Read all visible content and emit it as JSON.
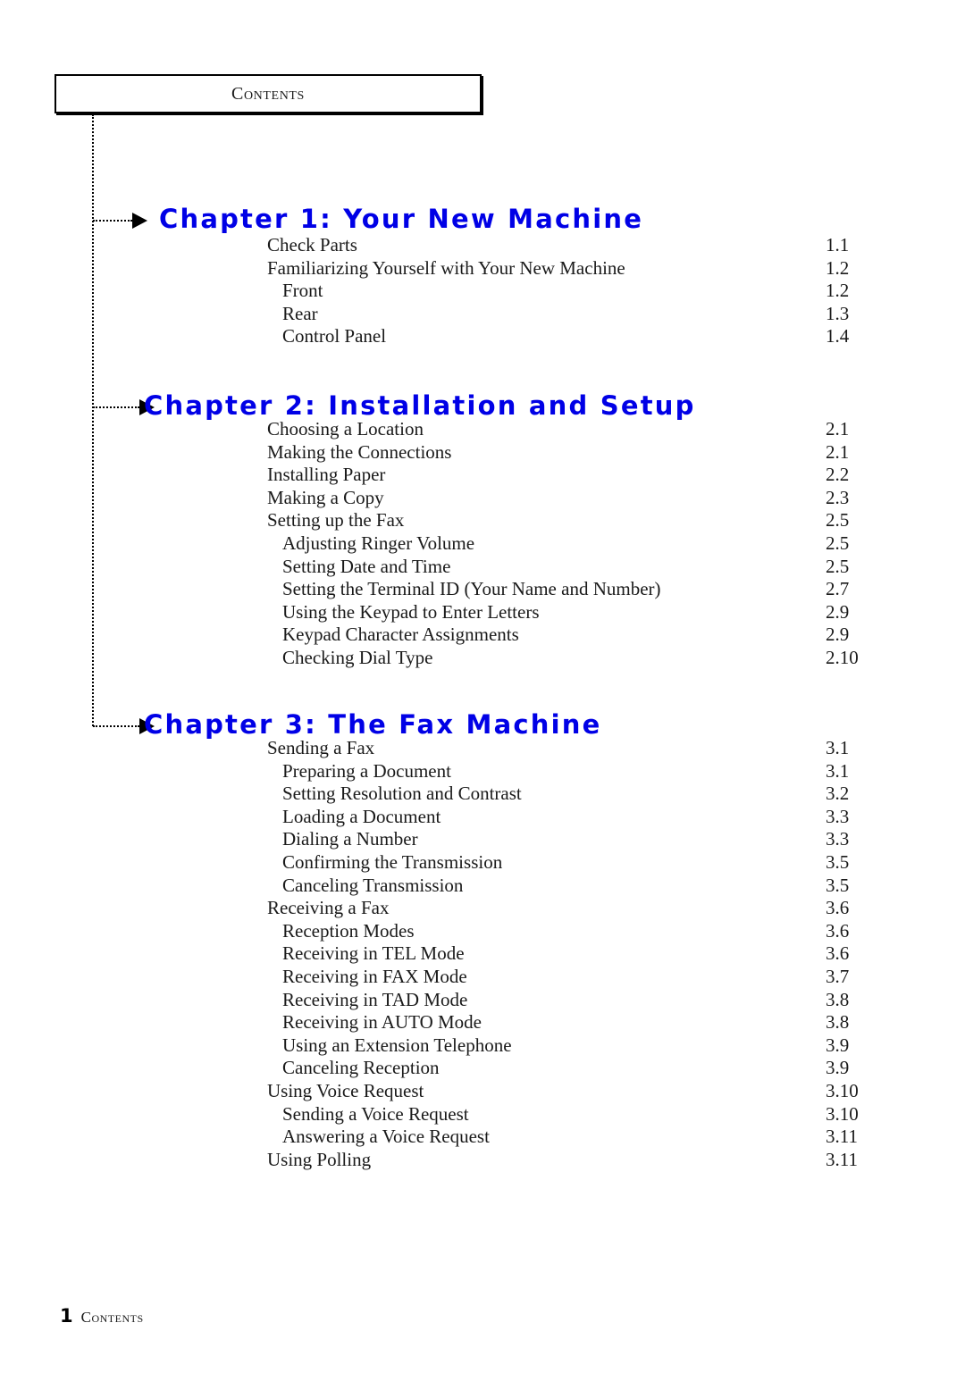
{
  "header": {
    "title": "Contents"
  },
  "footer": {
    "number": "1",
    "label": "Contents"
  },
  "colors": {
    "chapter_heading": "#0000E6",
    "text": "#1a1a1a",
    "rule": "#000000"
  },
  "chapters": [
    {
      "heading": "Chapter 1: Your New Machine",
      "entries": [
        {
          "label": "Check Parts",
          "page": "1.1",
          "level": 1
        },
        {
          "label": "Familiarizing Yourself with Your New Machine",
          "page": "1.2",
          "level": 1
        },
        {
          "label": "Front",
          "page": "1.2",
          "level": 2
        },
        {
          "label": "Rear",
          "page": "1.3",
          "level": 2
        },
        {
          "label": "Control Panel",
          "page": "1.4",
          "level": 2
        }
      ]
    },
    {
      "heading": "Chapter 2: Installation and Setup",
      "entries": [
        {
          "label": "Choosing a Location",
          "page": "2.1",
          "level": 1
        },
        {
          "label": "Making the Connections",
          "page": "2.1",
          "level": 1
        },
        {
          "label": "Installing Paper",
          "page": "2.2",
          "level": 1
        },
        {
          "label": "Making a Copy",
          "page": "2.3",
          "level": 1
        },
        {
          "label": "Setting up the Fax",
          "page": "2.5",
          "level": 1
        },
        {
          "label": "Adjusting Ringer Volume",
          "page": "2.5",
          "level": 2
        },
        {
          "label": "Setting Date and Time",
          "page": "2.5",
          "level": 2
        },
        {
          "label": "Setting the Terminal ID (Your Name and Number)",
          "page": "2.7",
          "level": 2
        },
        {
          "label": "Using the Keypad to Enter Letters",
          "page": "2.9",
          "level": 2
        },
        {
          "label": "Keypad Character Assignments",
          "page": "2.9",
          "level": 2
        },
        {
          "label": "Checking Dial Type",
          "page": "2.10",
          "level": 2
        }
      ]
    },
    {
      "heading": "Chapter 3: The Fax Machine",
      "entries": [
        {
          "label": "Sending a Fax",
          "page": "3.1",
          "level": 1
        },
        {
          "label": "Preparing a Document",
          "page": "3.1",
          "level": 2
        },
        {
          "label": "Setting Resolution and Contrast",
          "page": "3.2",
          "level": 2
        },
        {
          "label": "Loading a Document",
          "page": "3.3",
          "level": 2
        },
        {
          "label": "Dialing a Number",
          "page": "3.3",
          "level": 2
        },
        {
          "label": "Confirming the Transmission",
          "page": "3.5",
          "level": 2
        },
        {
          "label": "Canceling Transmission",
          "page": "3.5",
          "level": 2
        },
        {
          "label": "Receiving a Fax",
          "page": "3.6",
          "level": 1
        },
        {
          "label": "Reception Modes",
          "page": "3.6",
          "level": 2
        },
        {
          "label": "Receiving in TEL Mode",
          "page": "3.6",
          "level": 2
        },
        {
          "label": "Receiving in FAX Mode",
          "page": "3.7",
          "level": 2
        },
        {
          "label": "Receiving in TAD Mode",
          "page": "3.8",
          "level": 2
        },
        {
          "label": "Receiving in AUTO Mode",
          "page": "3.8",
          "level": 2
        },
        {
          "label": "Using an Extension Telephone",
          "page": "3.9",
          "level": 2
        },
        {
          "label": "Canceling Reception",
          "page": "3.9",
          "level": 2
        },
        {
          "label": "Using Voice Request",
          "page": "3.10",
          "level": 1
        },
        {
          "label": "Sending a Voice Request",
          "page": "3.10",
          "level": 2
        },
        {
          "label": "Answering a Voice Request",
          "page": "3.11",
          "level": 2
        },
        {
          "label": "Using Polling",
          "page": "3.11",
          "level": 1
        }
      ]
    }
  ],
  "layout": {
    "chapter_tops": [
      228,
      437,
      794
    ],
    "heading_lefts": [
      178,
      161,
      161
    ],
    "branch_tops": [
      246,
      455,
      812
    ],
    "branch_lefts": [
      104,
      104,
      104
    ],
    "branch_widths": [
      44,
      52,
      52
    ],
    "arrow_lefts": [
      148,
      156,
      156
    ],
    "entry_start_tops": [
      264,
      470,
      827
    ],
    "entry_line_height": 25.6,
    "indent_level1": 299,
    "indent_level2": 316
  }
}
